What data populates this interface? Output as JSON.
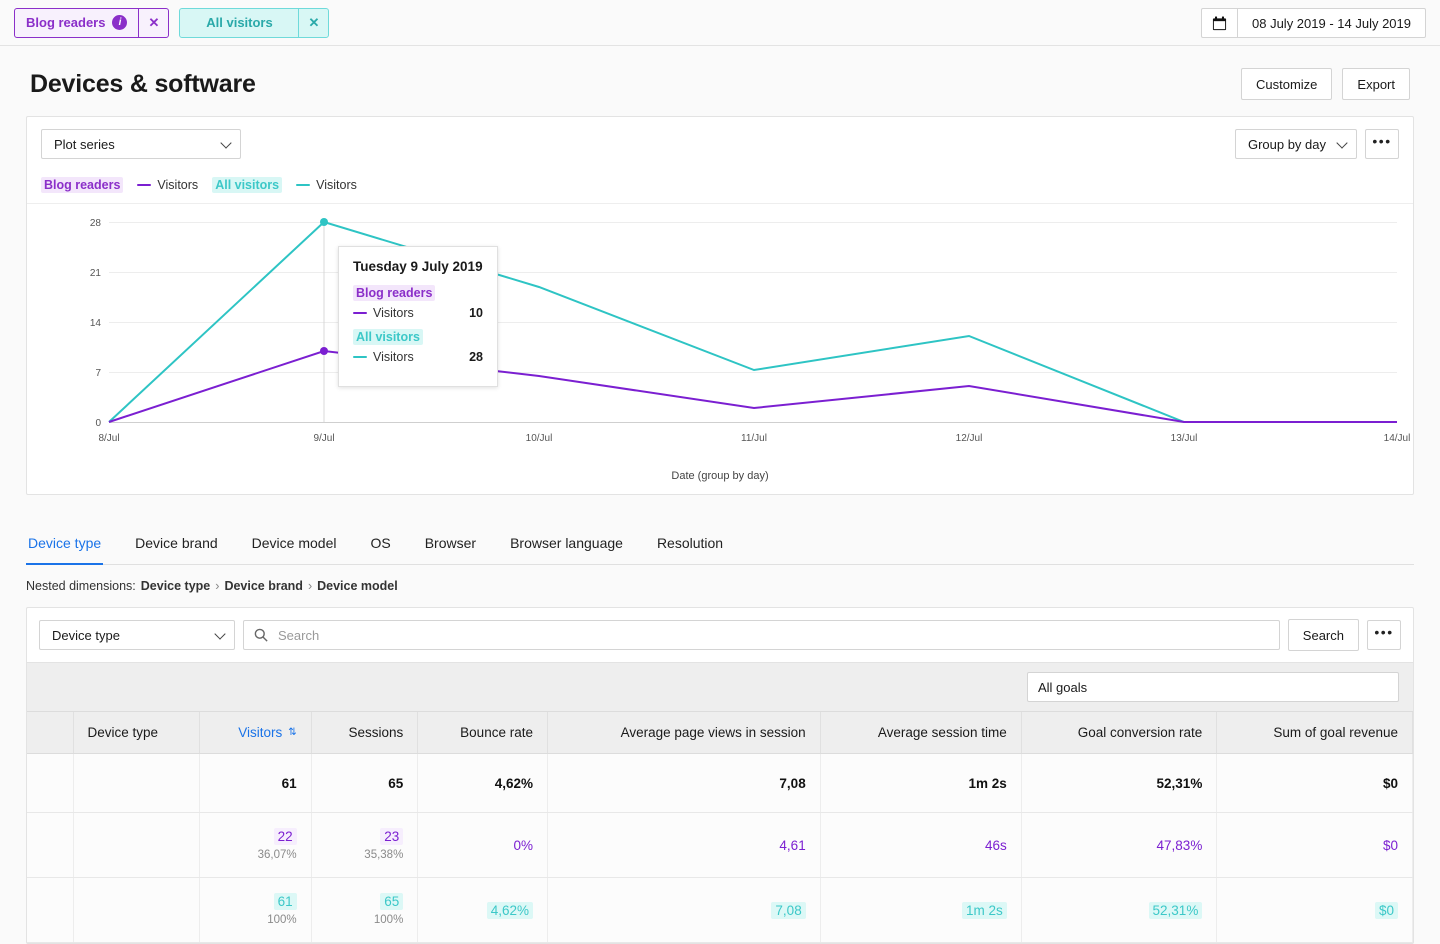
{
  "topbar": {
    "segments": [
      {
        "label": "Blog readers",
        "type": "purple",
        "has_info": true,
        "close": "✕"
      },
      {
        "label": "All visitors",
        "type": "teal",
        "has_info": false,
        "close": "✕"
      }
    ],
    "date_range": "08 July 2019 - 14 July 2019",
    "calendar_icon": "calendar-icon"
  },
  "header": {
    "title": "Devices & software",
    "customize_label": "Customize",
    "export_label": "Export"
  },
  "chart_toolbar": {
    "plot_series_label": "Plot series",
    "group_by_label": "Group by day",
    "more_label": "•••"
  },
  "legend": [
    {
      "segment": "Blog readers",
      "metric": "Visitors",
      "color": "#8b2fc9",
      "type": "purple"
    },
    {
      "segment": "All visitors",
      "metric": "Visitors",
      "color": "#3cc8c8",
      "type": "teal"
    }
  ],
  "tooltip": {
    "title": "Tuesday 9 July 2019",
    "rows": [
      {
        "segment": "Blog readers",
        "type": "purple",
        "metric": "Visitors",
        "value": "10"
      },
      {
        "segment": "All visitors",
        "type": "teal",
        "metric": "Visitors",
        "value": "28"
      }
    ]
  },
  "chart_data": {
    "type": "line",
    "title": "",
    "xlabel": "Date (group by day)",
    "ylabel": "",
    "x": [
      "8/Jul",
      "9/Jul",
      "10/Jul",
      "11/Jul",
      "12/Jul",
      "13/Jul",
      "14/Jul"
    ],
    "yticks": [
      0,
      7,
      14,
      21,
      28
    ],
    "ylim": [
      0,
      28
    ],
    "grid": true,
    "legend_position": "top-left",
    "series": [
      {
        "name": "Blog readers — Visitors",
        "color": "#7b1fd1",
        "values": [
          0,
          10,
          6.5,
          2,
          5,
          0,
          0
        ]
      },
      {
        "name": "All visitors — Visitors",
        "color": "#2ec4c4",
        "values": [
          0,
          28,
          19,
          7.3,
          12,
          0,
          0
        ]
      }
    ]
  },
  "tabs": [
    {
      "label": "Device type",
      "active": true
    },
    {
      "label": "Device brand",
      "active": false
    },
    {
      "label": "Device model",
      "active": false
    },
    {
      "label": "OS",
      "active": false
    },
    {
      "label": "Browser",
      "active": false
    },
    {
      "label": "Browser language",
      "active": false
    },
    {
      "label": "Resolution",
      "active": false
    }
  ],
  "nested": {
    "prefix": "Nested dimensions:",
    "items": [
      "Device type",
      "Device brand",
      "Device model"
    ],
    "separator": "›"
  },
  "table_controls": {
    "dimension_label": "Device type",
    "search_placeholder": "Search",
    "search_value": "",
    "search_button": "Search",
    "more_label": "•••",
    "goals_label": "All goals"
  },
  "table": {
    "columns": [
      {
        "label": "",
        "align": "left"
      },
      {
        "label": "Device type",
        "align": "left"
      },
      {
        "label": "Visitors",
        "align": "right",
        "sorted": true,
        "sort_icon": "▲▼"
      },
      {
        "label": "Sessions",
        "align": "right"
      },
      {
        "label": "Bounce rate",
        "align": "right"
      },
      {
        "label": "Average page views in session",
        "align": "right"
      },
      {
        "label": "Average session time",
        "align": "right"
      },
      {
        "label": "Goal conversion rate",
        "align": "right"
      },
      {
        "label": "Sum of goal revenue",
        "align": "right"
      }
    ],
    "rows": [
      {
        "style": "total",
        "device_type": "",
        "cells": [
          {
            "value": "61"
          },
          {
            "value": "65"
          },
          {
            "value": "4,62%"
          },
          {
            "value": "7,08"
          },
          {
            "value": "1m 2s"
          },
          {
            "value": "52,31%"
          },
          {
            "value": "$0"
          }
        ]
      },
      {
        "style": "purple",
        "device_type": "",
        "cells": [
          {
            "value": "22",
            "sub": "36,07%",
            "highlight": true
          },
          {
            "value": "23",
            "sub": "35,38%",
            "highlight": true
          },
          {
            "value": "0%"
          },
          {
            "value": "4,61"
          },
          {
            "value": "46s"
          },
          {
            "value": "47,83%"
          },
          {
            "value": "$0"
          }
        ]
      },
      {
        "style": "teal",
        "device_type": "",
        "cells": [
          {
            "value": "61",
            "sub": "100%",
            "highlight": true
          },
          {
            "value": "65",
            "sub": "100%",
            "highlight": true
          },
          {
            "value": "4,62%",
            "highlight": true
          },
          {
            "value": "7,08",
            "highlight": true
          },
          {
            "value": "1m 2s",
            "highlight": true
          },
          {
            "value": "52,31%",
            "highlight": true
          },
          {
            "value": "$0",
            "highlight": true
          }
        ]
      }
    ]
  },
  "colors": {
    "purple": "#8b2fc9",
    "teal": "#2ec4c4",
    "accent_blue": "#1a73e8"
  }
}
